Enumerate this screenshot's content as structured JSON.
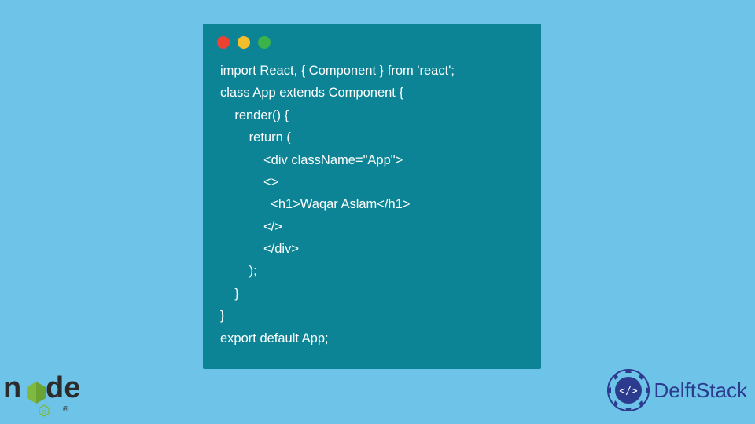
{
  "window": {
    "traffic_lights": [
      "red",
      "yellow",
      "green"
    ]
  },
  "code": {
    "lines": [
      "import React, { Component } from 'react';",
      "class App extends Component {",
      "    render() {",
      "        return (",
      "            <div className=\"App\">",
      "            <>",
      "              <h1>Waqar Aslam</h1>",
      "            </>",
      "            </div>",
      "        );",
      "    }",
      "}",
      "export default App;"
    ]
  },
  "logos": {
    "nodejs": "node",
    "delftstack": "DelftStack"
  },
  "colors": {
    "page_bg": "#6dc4e8",
    "window_bg": "#0d8496",
    "code_text": "#ffffff",
    "delft_brand": "#2d3b8f"
  }
}
